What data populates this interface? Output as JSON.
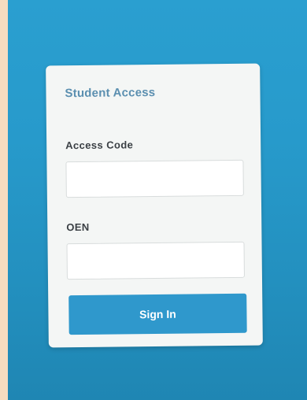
{
  "login_card": {
    "title": "Student Access",
    "access_code": {
      "label": "Access Code",
      "value": "",
      "placeholder": ""
    },
    "oen": {
      "label": "OEN",
      "value": "",
      "placeholder": ""
    },
    "sign_in_label": "Sign In"
  },
  "colors": {
    "background": "#2a9fd0",
    "card": "#f4f6f5",
    "accent": "#2f98cc",
    "title": "#5b8fb0"
  }
}
